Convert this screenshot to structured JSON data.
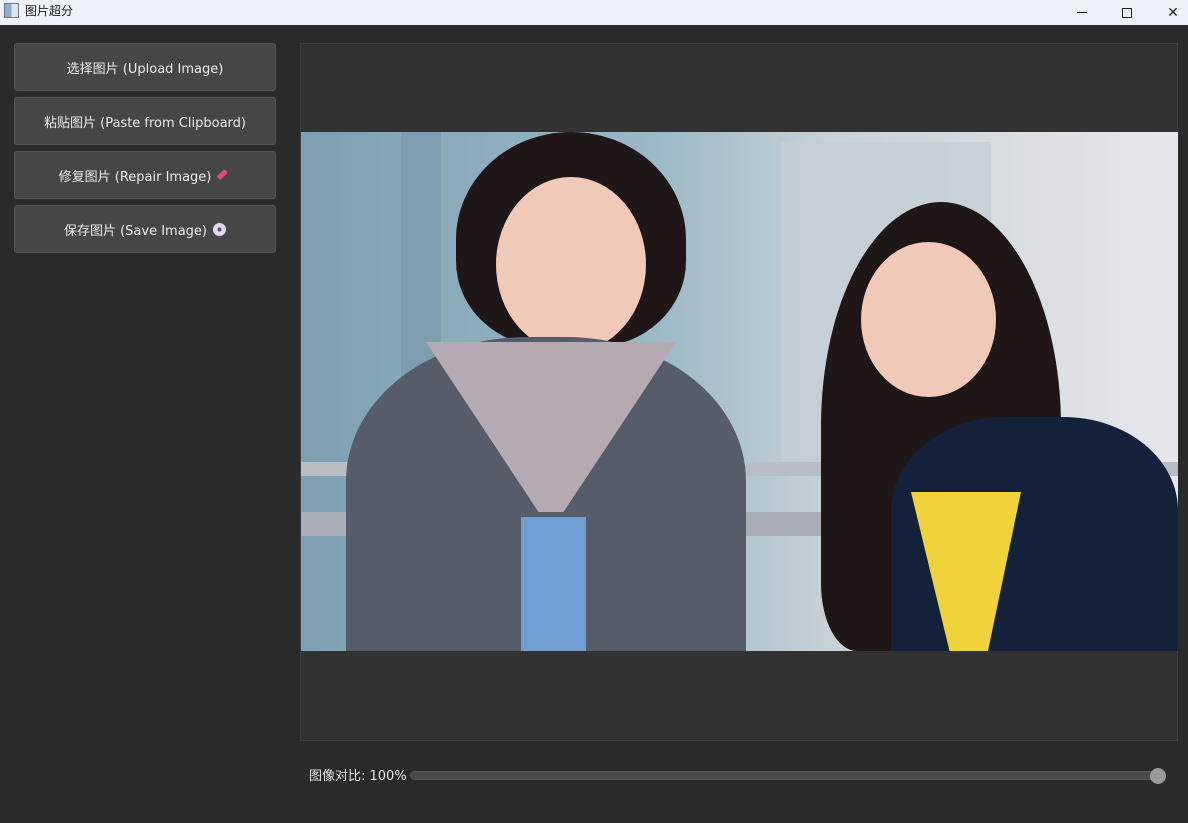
{
  "window": {
    "title": "图片超分",
    "controls": {
      "minimize": "minimize-icon",
      "maximize": "maximize-icon",
      "close": "close-icon"
    }
  },
  "sidebar": {
    "upload_label": "选择图片 (Upload Image)",
    "paste_label": "粘贴图片 (Paste from Clipboard)",
    "repair_label": "修复图片 (Repair Image)",
    "repair_icon": "rocket-icon",
    "save_label": "保存图片 (Save Image)",
    "save_icon": "disc-icon"
  },
  "preview": {
    "image": "photo of two girls in school uniforms by a window"
  },
  "contrast": {
    "label": "图像对比: 100%",
    "value_percent": 100
  }
}
